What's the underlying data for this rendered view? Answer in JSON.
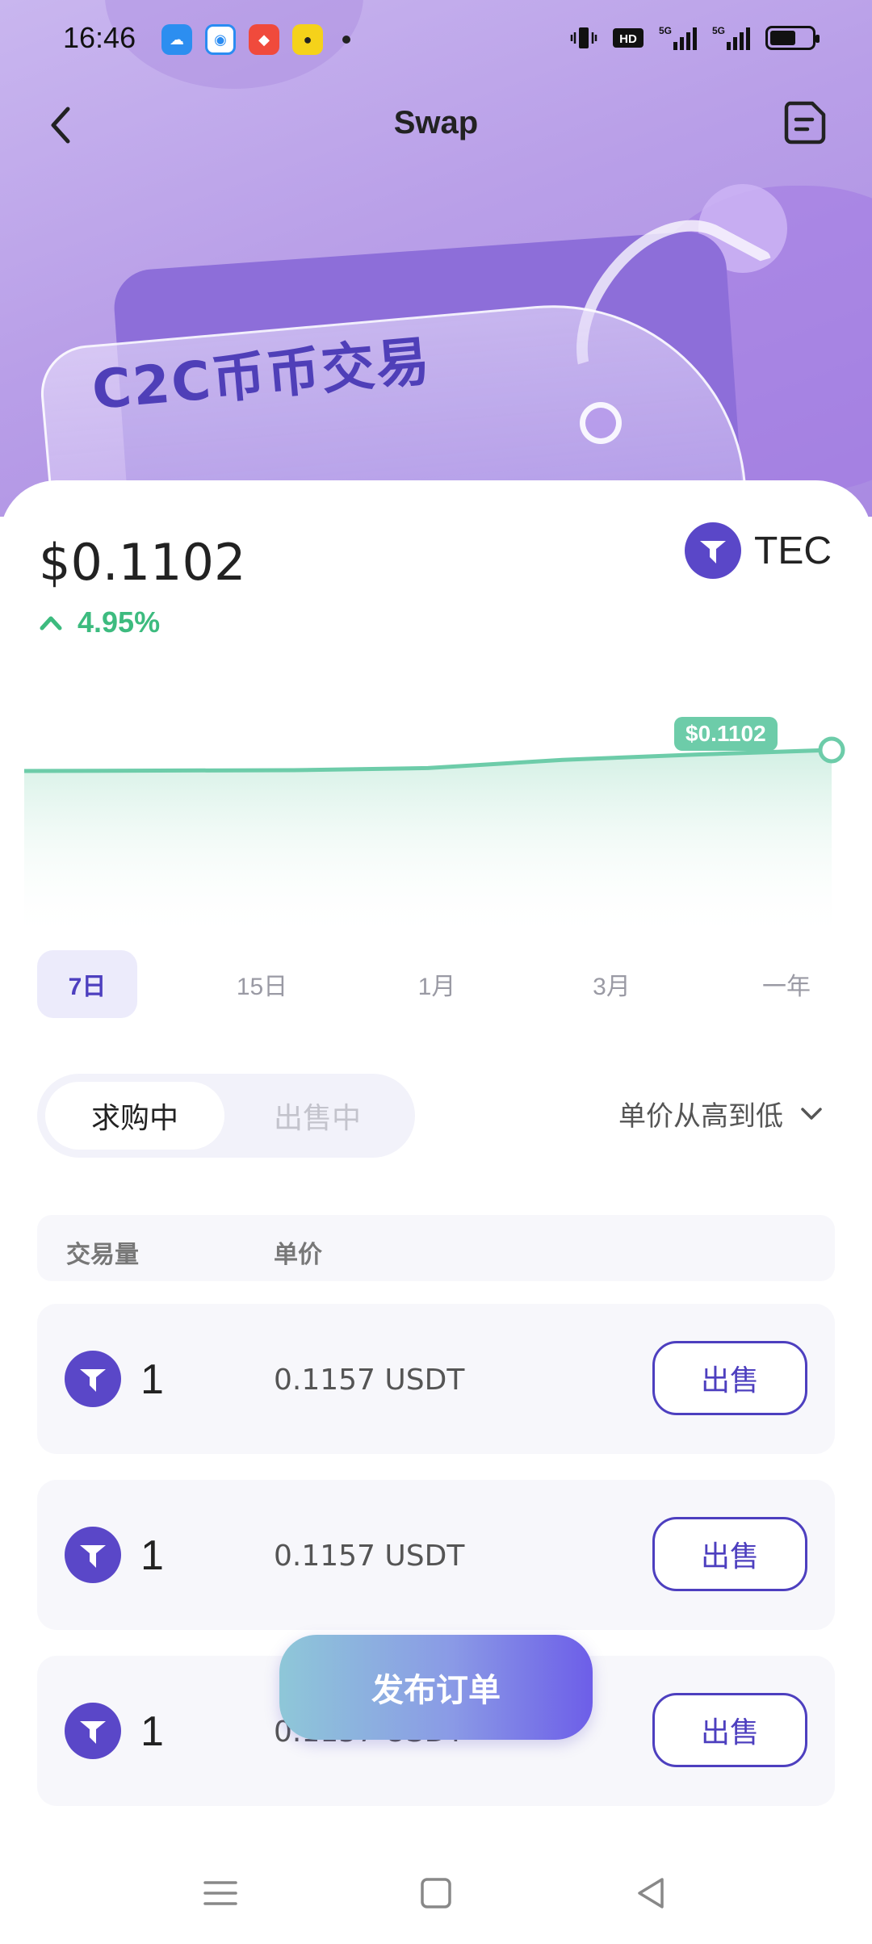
{
  "status_bar": {
    "time": "16:46",
    "app_icons": [
      "weather-icon",
      "qq-browser-icon",
      "shopping-icon",
      "video-app-icon"
    ],
    "network": "5G",
    "hd_label": "HD"
  },
  "nav": {
    "title": "Swap",
    "back_icon": "chevron-left-icon",
    "record_icon": "document-icon"
  },
  "banner": {
    "text": "C2C币币交易"
  },
  "market": {
    "price": "$0.1102",
    "change": "4.95%",
    "change_direction": "up",
    "coin_symbol": "TEC",
    "chart_tag": "$0.1102"
  },
  "periods": [
    {
      "label": "7日",
      "active": true
    },
    {
      "label": "15日",
      "active": false
    },
    {
      "label": "1月",
      "active": false
    },
    {
      "label": "3月",
      "active": false
    },
    {
      "label": "一年",
      "active": false
    }
  ],
  "tabs": {
    "buying": "求购中",
    "selling": "出售中",
    "active": "buying"
  },
  "sort": {
    "label": "单价从高到低"
  },
  "table": {
    "headers": {
      "volume": "交易量",
      "price": "单价"
    },
    "rows": [
      {
        "qty": "1",
        "price": "0.1157 USDT",
        "action": "出售"
      },
      {
        "qty": "1",
        "price": "0.1157 USDT",
        "action": "出售"
      },
      {
        "qty": "1",
        "price": "0.1157 USDT",
        "action": "出售"
      }
    ]
  },
  "publish_button": "发布订单",
  "colors": {
    "accent": "#4d3fbf",
    "positive": "#3dbb7f",
    "chart_line": "#6dcca9",
    "hero": "#b99fe8"
  },
  "chart_data": {
    "type": "area",
    "values": [
      0.1051,
      0.1052,
      0.1053,
      0.1058,
      0.1078,
      0.1091,
      0.1102
    ],
    "ylim": [
      0.0,
      0.1102
    ],
    "grid": false
  }
}
